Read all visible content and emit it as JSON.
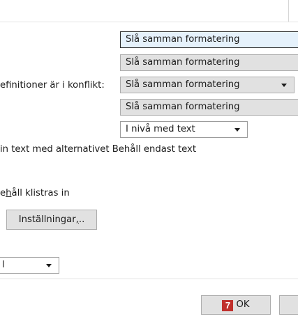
{
  "paste_options": {
    "dropdown_1": {
      "value": "Slå samman formatering"
    },
    "dropdown_2": {
      "value": "Slå samman formatering"
    },
    "row_3_label": "efinitioner är i konflikt:",
    "dropdown_3": {
      "value": "Slå samman formatering"
    },
    "dropdown_4": {
      "value": "Slå samman formatering"
    },
    "dropdown_5": {
      "value": "I nivå med text"
    },
    "text_only_line": "in text med alternativet Behåll endast text",
    "keep_pasted_pre": "e",
    "keep_pasted_underline": "h",
    "keep_pasted_post": "åll klistras in",
    "settings_button": {
      "pre": "Inställningar",
      "underline": ",",
      "post": ".."
    },
    "small_dropdown": {
      "value": "l"
    }
  },
  "footer": {
    "ok_badge": "7",
    "ok_label": "OK"
  },
  "colors": {
    "badge": "#c0302c",
    "focus_fill": "#e5f1fb",
    "button_fill": "#e1e1e1"
  }
}
